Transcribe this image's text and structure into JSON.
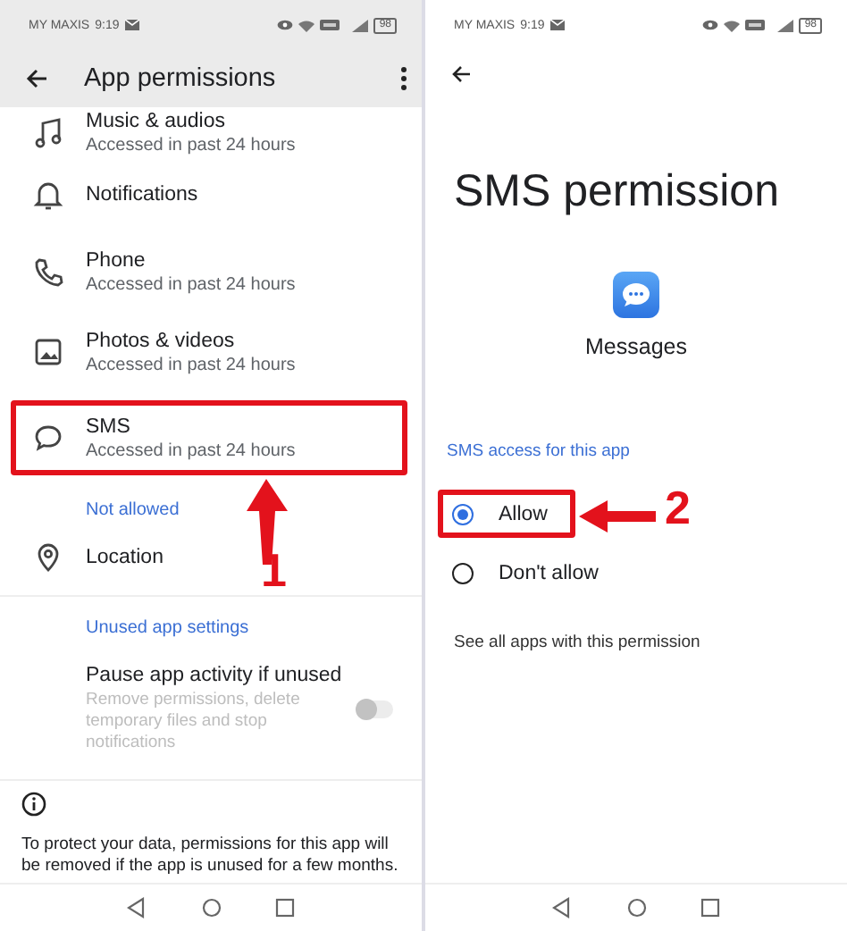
{
  "left_screen": {
    "status_bar": {
      "carrier": "MY MAXIS",
      "time": "9:19",
      "battery": "98"
    },
    "app_bar": {
      "title": "App permissions"
    },
    "allowed_items": [
      {
        "kind": "music",
        "title": "Music & audios",
        "subtitle": "Accessed in past 24 hours",
        "highlighted": false
      },
      {
        "kind": "bell",
        "title": "Notifications",
        "highlighted": false
      },
      {
        "kind": "phone",
        "title": "Phone",
        "subtitle": "Accessed in past 24 hours",
        "highlighted": false
      },
      {
        "kind": "photo",
        "title": "Photos & videos",
        "subtitle": "Accessed in past 24 hours",
        "highlighted": false
      },
      {
        "kind": "chat",
        "title": "SMS",
        "subtitle": "Accessed in past 24 hours",
        "highlighted": true
      }
    ],
    "not_allowed_header": "Not allowed",
    "not_allowed_items": [
      {
        "kind": "pin",
        "title": "Location",
        "highlighted": false
      }
    ],
    "unused_header": "Unused app settings",
    "pause_setting": {
      "title": "Pause app activity if unused",
      "description": "Remove permissions, delete temporary files and stop notifications",
      "on": false,
      "disabled": true
    },
    "info_text": "To protect your data, permissions for this app will be removed if the app is unused for a few months."
  },
  "right_screen": {
    "status_bar": {
      "carrier": "MY MAXIS",
      "time": "9:19",
      "battery": "98"
    },
    "title": "SMS permission",
    "app_name": "Messages",
    "section_header": "SMS access for this app",
    "options": [
      {
        "label": "Allow",
        "selected": true,
        "highlighted": true
      },
      {
        "label": "Don't allow",
        "selected": false,
        "highlighted": false
      }
    ],
    "link": "See all apps with this permission"
  },
  "annotations": [
    {
      "label": "1"
    },
    {
      "label": "2"
    }
  ]
}
